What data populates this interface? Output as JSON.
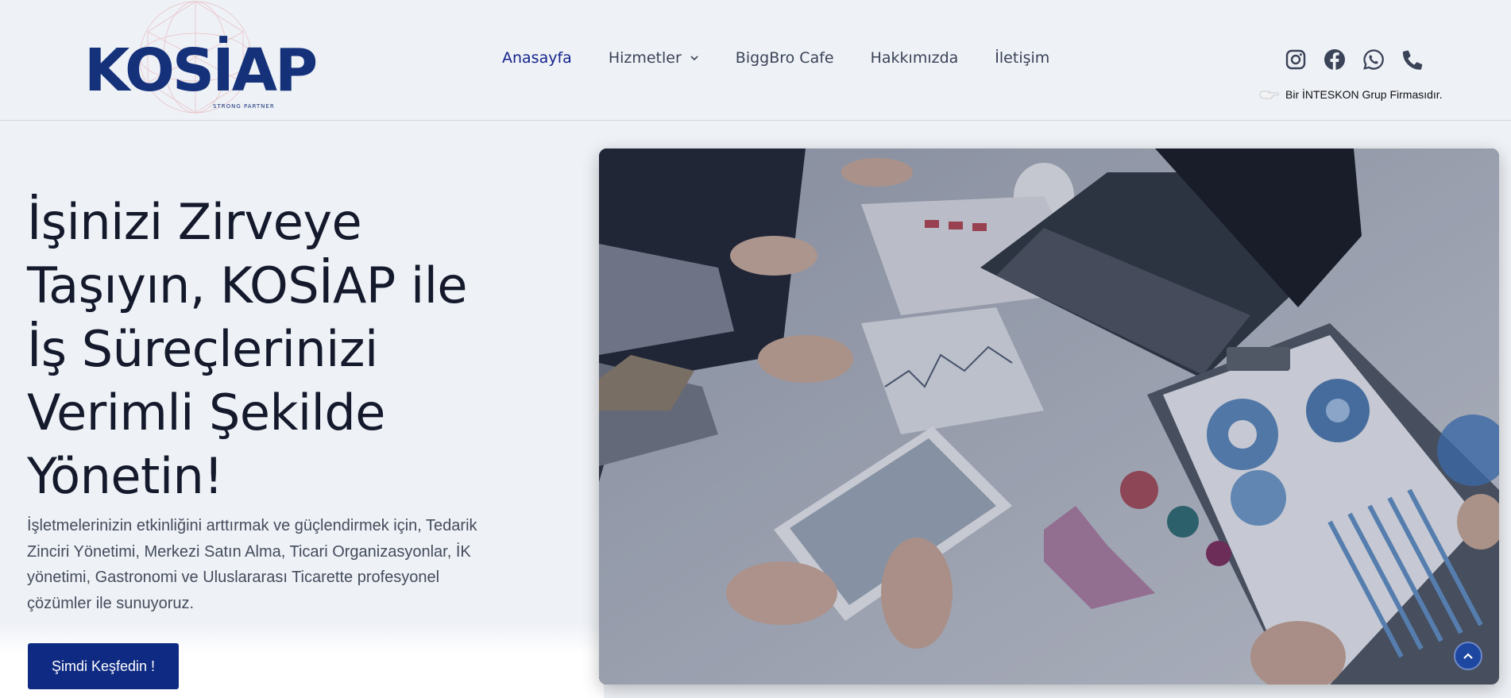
{
  "brand": {
    "logo_text": "KOSİAP",
    "tagline": "STRONG PARTNER"
  },
  "nav": {
    "items": [
      {
        "label": "Anasayfa",
        "active": true
      },
      {
        "label": "Hizmetler",
        "has_dropdown": true
      },
      {
        "label": "BiggBro Cafe"
      },
      {
        "label": "Hakkımızda"
      },
      {
        "label": "İletişim"
      }
    ]
  },
  "social": {
    "icons": [
      "instagram-icon",
      "facebook-icon",
      "whatsapp-icon",
      "phone-icon"
    ]
  },
  "group_note": "Bir İNTESKON Grup Firmasıdır.",
  "hero": {
    "title_lines": [
      "İşinizi Zirveye",
      "Taşıyın, KOSİAP ile",
      "İş Süreçlerinizi",
      "Verimli Şekilde",
      "Yönetin!"
    ],
    "description_lines": [
      "İşletmelerinizin etkinliğini arttırmak ve güçlendirmek için, Tedarik",
      "Zinciri Yönetimi, Merkezi Satın Alma, Ticari Organizasyonlar, İK",
      "yönetimi, Gastronomi ve Uluslararası Ticarette profesyonel",
      "çözümler ile sunuyoruz."
    ],
    "cta_label": "Şimdi Keşfedin !"
  },
  "colors": {
    "brand_blue": "#14317a",
    "nav_active": "#14238a",
    "cta_bg": "#0f2a82",
    "page_bg": "#eef1f6"
  }
}
